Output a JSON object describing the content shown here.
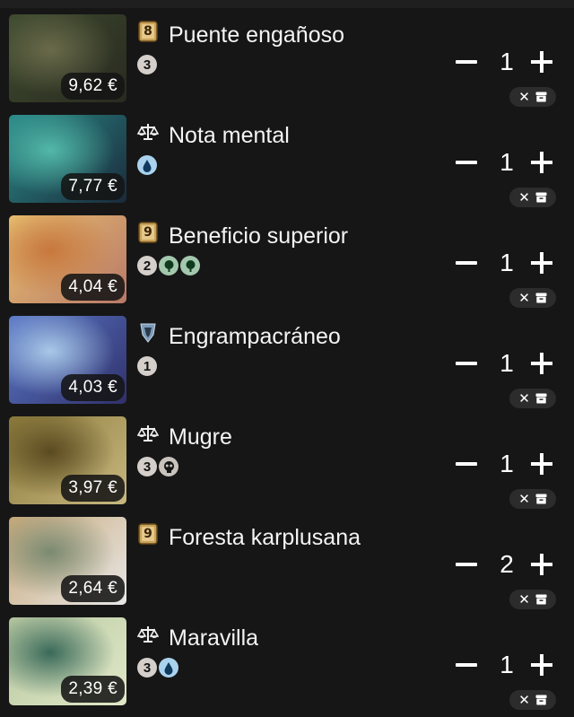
{
  "colors": {
    "background": "#161616",
    "text": "#f2f2f2",
    "mana_generic": "#d4cfca",
    "mana_blue": "#aad2ee",
    "mana_green": "#a3c8ae",
    "mana_black": "#c9c3bd"
  },
  "cards": [
    {
      "name": "Puente engañoso",
      "price": "9,62 €",
      "set_icon": "numbered-card-8-icon",
      "set_label": "8",
      "mana": [
        {
          "type": "generic",
          "label": "3"
        }
      ],
      "quantity": "1",
      "art_colors": [
        "#3c4a2e",
        "#6a6a4a",
        "#2a2a20"
      ]
    },
    {
      "name": "Nota mental",
      "price": "7,77 €",
      "set_icon": "scales-icon",
      "set_label": "",
      "mana": [
        {
          "type": "blue",
          "label": ""
        }
      ],
      "quantity": "1",
      "art_colors": [
        "#2a8a88",
        "#52b8a8",
        "#1a2a3a"
      ]
    },
    {
      "name": "Beneficio superior",
      "price": "4,04 €",
      "set_icon": "numbered-card-9-icon",
      "set_label": "9",
      "mana": [
        {
          "type": "generic",
          "label": "2"
        },
        {
          "type": "green",
          "label": ""
        },
        {
          "type": "green",
          "label": ""
        }
      ],
      "quantity": "1",
      "art_colors": [
        "#e8c070",
        "#c8783c",
        "#b87868"
      ]
    },
    {
      "name": "Engrampacráneo",
      "price": "4,03 €",
      "set_icon": "shield-set-icon",
      "set_label": "",
      "mana": [
        {
          "type": "generic",
          "label": "1"
        }
      ],
      "quantity": "1",
      "art_colors": [
        "#5a78c8",
        "#a8c8e8",
        "#30306a"
      ]
    },
    {
      "name": "Mugre",
      "price": "3,97 €",
      "set_icon": "scales-icon",
      "set_label": "",
      "mana": [
        {
          "type": "generic",
          "label": "3"
        },
        {
          "type": "black",
          "label": ""
        }
      ],
      "quantity": "1",
      "art_colors": [
        "#8a7a3a",
        "#5a4a20",
        "#c8b880"
      ]
    },
    {
      "name": "Foresta karplusana",
      "price": "2,64 €",
      "set_icon": "numbered-card-9-icon",
      "set_label": "9",
      "mana": [],
      "quantity": "2",
      "art_colors": [
        "#c8a878",
        "#7a8a70",
        "#e8e8e8"
      ]
    },
    {
      "name": "Maravilla",
      "price": "2,39 €",
      "set_icon": "scales-icon",
      "set_label": "",
      "mana": [
        {
          "type": "generic",
          "label": "3"
        },
        {
          "type": "blue",
          "label": ""
        }
      ],
      "quantity": "1",
      "art_colors": [
        "#b8c8a0",
        "#3a6a5a",
        "#e0e8c8"
      ]
    }
  ]
}
